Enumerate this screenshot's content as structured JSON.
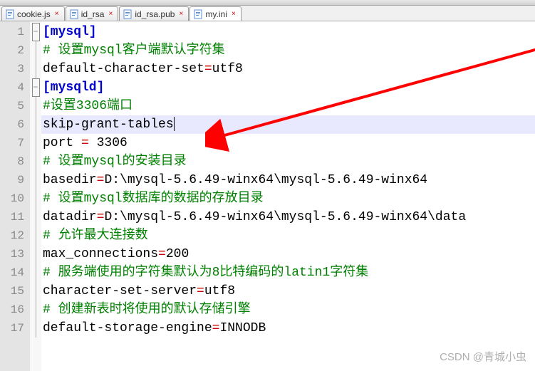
{
  "toolbar": {
    "icons": [
      "new",
      "open",
      "save",
      "cut",
      "copy",
      "paste",
      "undo",
      "redo",
      "find",
      "replace",
      "zoom",
      "macro",
      "run"
    ]
  },
  "tabs": [
    {
      "name": "cookie.js",
      "active": false,
      "icon": "js"
    },
    {
      "name": "id_rsa",
      "active": false,
      "icon": "file"
    },
    {
      "name": "id_rsa.pub",
      "active": false,
      "icon": "file"
    },
    {
      "name": "my.ini",
      "active": true,
      "icon": "ini"
    }
  ],
  "code": {
    "lines": [
      {
        "n": 1,
        "fold": "open",
        "seg": [
          {
            "t": "[mysql]",
            "c": "sect"
          }
        ]
      },
      {
        "n": 2,
        "fold": "bar",
        "seg": [
          {
            "t": "# 设置mysql客户端默认字符集",
            "c": "cmt"
          }
        ]
      },
      {
        "n": 3,
        "fold": "bar",
        "seg": [
          {
            "t": "default-character-set",
            "c": "val"
          },
          {
            "t": "=",
            "c": "op"
          },
          {
            "t": "utf8",
            "c": "val"
          }
        ]
      },
      {
        "n": 4,
        "fold": "open",
        "seg": [
          {
            "t": "[mysqld]",
            "c": "sect"
          }
        ]
      },
      {
        "n": 5,
        "fold": "bar",
        "seg": [
          {
            "t": "#设置3306端口",
            "c": "cmt"
          }
        ]
      },
      {
        "n": 6,
        "fold": "bar",
        "hl": true,
        "seg": [
          {
            "t": "skip-grant-tables",
            "c": "val"
          }
        ],
        "caret": true
      },
      {
        "n": 7,
        "fold": "bar",
        "seg": [
          {
            "t": "port ",
            "c": "val"
          },
          {
            "t": "=",
            "c": "op"
          },
          {
            "t": " 3306",
            "c": "val"
          }
        ]
      },
      {
        "n": 8,
        "fold": "bar",
        "seg": [
          {
            "t": "# 设置mysql的安装目录",
            "c": "cmt"
          }
        ]
      },
      {
        "n": 9,
        "fold": "bar",
        "seg": [
          {
            "t": "basedir",
            "c": "val"
          },
          {
            "t": "=",
            "c": "op"
          },
          {
            "t": "D:\\mysql-5.6.49-winx64\\mysql-5.6.49-winx64",
            "c": "val"
          }
        ]
      },
      {
        "n": 10,
        "fold": "bar",
        "seg": [
          {
            "t": "# 设置mysql数据库的数据的存放目录",
            "c": "cmt"
          }
        ]
      },
      {
        "n": 11,
        "fold": "bar",
        "seg": [
          {
            "t": "datadir",
            "c": "val"
          },
          {
            "t": "=",
            "c": "op"
          },
          {
            "t": "D:\\mysql-5.6.49-winx64\\mysql-5.6.49-winx64\\data",
            "c": "val"
          }
        ]
      },
      {
        "n": 12,
        "fold": "bar",
        "seg": [
          {
            "t": "# 允许最大连接数",
            "c": "cmt"
          }
        ]
      },
      {
        "n": 13,
        "fold": "bar",
        "seg": [
          {
            "t": "max_connections",
            "c": "val"
          },
          {
            "t": "=",
            "c": "op"
          },
          {
            "t": "200",
            "c": "val"
          }
        ]
      },
      {
        "n": 14,
        "fold": "bar",
        "seg": [
          {
            "t": "# 服务端使用的字符集默认为8比特编码的latin1字符集",
            "c": "cmt"
          }
        ]
      },
      {
        "n": 15,
        "fold": "bar",
        "seg": [
          {
            "t": "character-set-server",
            "c": "val"
          },
          {
            "t": "=",
            "c": "op"
          },
          {
            "t": "utf8",
            "c": "val"
          }
        ]
      },
      {
        "n": 16,
        "fold": "bar",
        "seg": [
          {
            "t": "# 创建新表时将使用的默认存储引擎",
            "c": "cmt"
          }
        ]
      },
      {
        "n": 17,
        "fold": "end",
        "seg": [
          {
            "t": "default-storage-engine",
            "c": "val"
          },
          {
            "t": "=",
            "c": "op"
          },
          {
            "t": "INNODB",
            "c": "val"
          }
        ]
      }
    ]
  },
  "watermark": "CSDN @青城小虫"
}
